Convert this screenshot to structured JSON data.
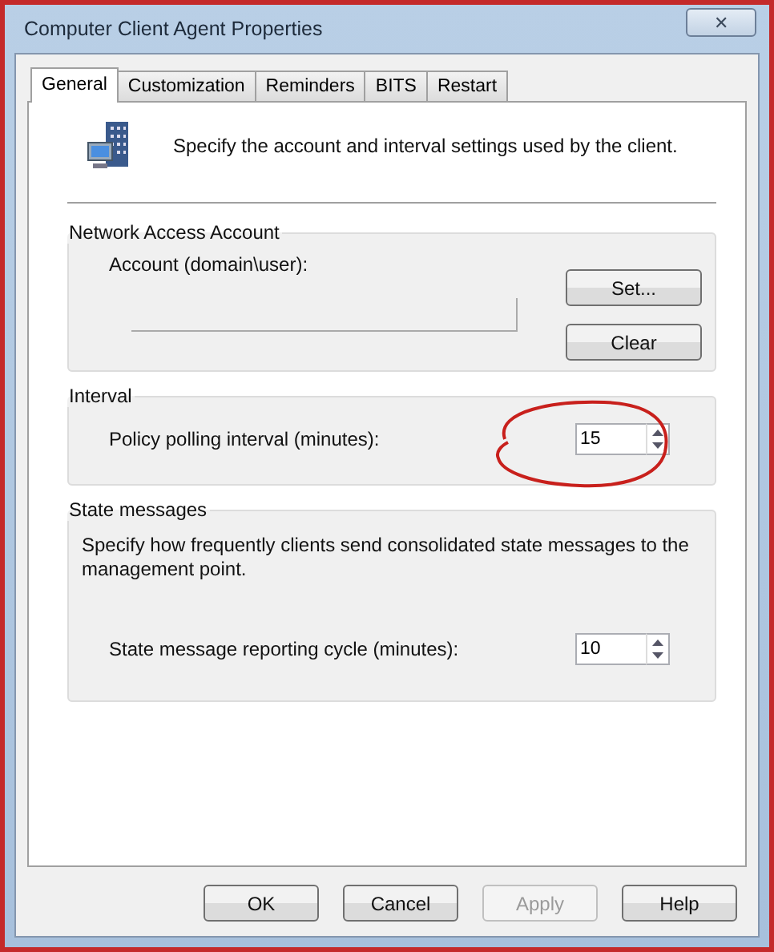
{
  "window": {
    "title": "Computer Client Agent Properties",
    "close": "✕"
  },
  "tabs": [
    {
      "label": "General",
      "selected": true
    },
    {
      "label": "Customization",
      "selected": false
    },
    {
      "label": "Reminders",
      "selected": false
    },
    {
      "label": "BITS",
      "selected": false
    },
    {
      "label": "Restart",
      "selected": false
    }
  ],
  "header": {
    "text": "Specify the account and interval settings used by the client."
  },
  "network_access_account": {
    "title": "Network Access Account",
    "label": "Account (domain\\user):",
    "buttons": [
      {
        "label": "Set...",
        "disabled": false
      },
      {
        "label": "Clear",
        "disabled": false
      }
    ]
  },
  "interval": {
    "title": "Interval",
    "label": "Policy polling interval (minutes):",
    "value": "15",
    "annotated": true
  },
  "state_messages": {
    "title": "State messages",
    "description": "Specify how frequently clients send consolidated state messages to the management point.",
    "label": "State message reporting cycle (minutes):",
    "value": "10",
    "annotated": false
  },
  "buttons": [
    {
      "label": "OK",
      "disabled": false
    },
    {
      "label": "Cancel",
      "disabled": false
    },
    {
      "label": "Apply",
      "disabled": true
    },
    {
      "label": "Help",
      "disabled": false
    }
  ]
}
